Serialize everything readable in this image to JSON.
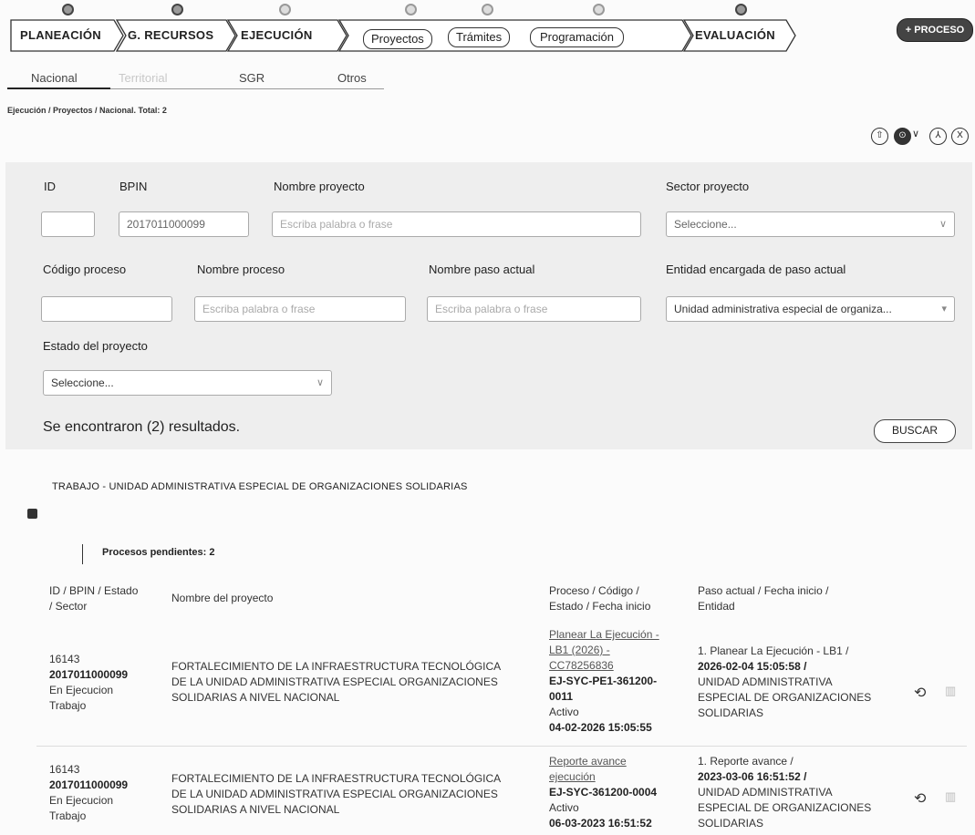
{
  "steps": [
    "PLANEACIÓN",
    "G. RECURSOS",
    "EJECUCIÓN",
    "EVALUACIÓN"
  ],
  "subtabs": [
    "Proyectos",
    "Trámites",
    "Programación"
  ],
  "proceso_button": "+ PROCESO",
  "tabs": [
    "Nacional",
    "Territorial",
    "SGR",
    "Otros"
  ],
  "breadcrumb": "Ejecución / Proyectos / Nacional. Total: 2",
  "filters": {
    "id_label": "ID",
    "bpin_label": "BPIN",
    "bpin_value": "2017011000099",
    "nombre_label": "Nombre proyecto",
    "nombre_placeholder": "Escriba palabra o frase",
    "sector_label": "Sector proyecto",
    "sector_value": "Seleccione...",
    "codigo_label": "Código proceso",
    "nombre_proceso_label": "Nombre proceso",
    "nombre_proceso_placeholder": "Escriba palabra o frase",
    "paso_label": "Nombre paso actual",
    "paso_placeholder": "Escriba palabra o frase",
    "entidad_label": "Entidad encargada de paso actual",
    "entidad_value": "Unidad administrativa especial de organiza...",
    "estado_label": "Estado del proyecto",
    "estado_value": "Seleccione..."
  },
  "results_text": "Se encontraron (2) resultados.",
  "buscar_label": "BUSCAR",
  "group_title": "TRABAJO - UNIDAD ADMINISTRATIVA ESPECIAL DE ORGANIZACIONES SOLIDARIAS",
  "pending": "Procesos pendientes: 2",
  "headers": {
    "c1a": "ID / BPIN / Estado",
    "c1b": "/ Sector",
    "c2": "Nombre del proyecto",
    "c3a": "Proceso / Código /",
    "c3b": "Estado / Fecha inicio",
    "c4a": "Paso actual / Fecha inicio /",
    "c4b": "Entidad"
  },
  "rows": [
    {
      "id": "16143",
      "bpin": "2017011000099",
      "estado": "En Ejecucion",
      "sector": "Trabajo",
      "nombre1": "FORTALECIMIENTO DE LA INFRAESTRUCTURA TECNOLÓGICA",
      "nombre2": "DE LA UNIDAD ADMINISTRATIVA ESPECIAL ORGANIZACIONES",
      "nombre3": "SOLIDARIAS A NIVEL NACIONAL",
      "proc1": "Planear La Ejecución -",
      "proc2": "LB1 (2026) -",
      "proc3": "CC78256836",
      "codigo1": "EJ-SYC-PE1-361200-",
      "codigo2": "0011",
      "proc_estado": "Activo",
      "proc_fecha": "04-02-2026 15:05:55",
      "paso1": "1. Planear La Ejecución - LB1 /",
      "paso_fecha": "2026-02-04 15:05:58 /",
      "ent1": "UNIDAD ADMINISTRATIVA",
      "ent2": "ESPECIAL DE ORGANIZACIONES",
      "ent3": "SOLIDARIAS"
    },
    {
      "id": "16143",
      "bpin": "2017011000099",
      "estado": "En Ejecucion",
      "sector": "Trabajo",
      "nombre1": "FORTALECIMIENTO DE LA INFRAESTRUCTURA TECNOLÓGICA",
      "nombre2": "DE LA UNIDAD ADMINISTRATIVA ESPECIAL ORGANIZACIONES",
      "nombre3": "SOLIDARIAS A NIVEL NACIONAL",
      "proc1": "Reporte avance",
      "proc2": "ejecución",
      "codigo1": "EJ-SYC-361200-0004",
      "proc_estado": "Activo",
      "proc_fecha": "06-03-2023 16:51:52",
      "paso1": "1. Reporte avance /",
      "paso_fecha": "2023-03-06 16:51:52 /",
      "ent1": "UNIDAD ADMINISTRATIVA",
      "ent2": "ESPECIAL DE ORGANIZACIONES",
      "ent3": "SOLIDARIAS"
    }
  ]
}
